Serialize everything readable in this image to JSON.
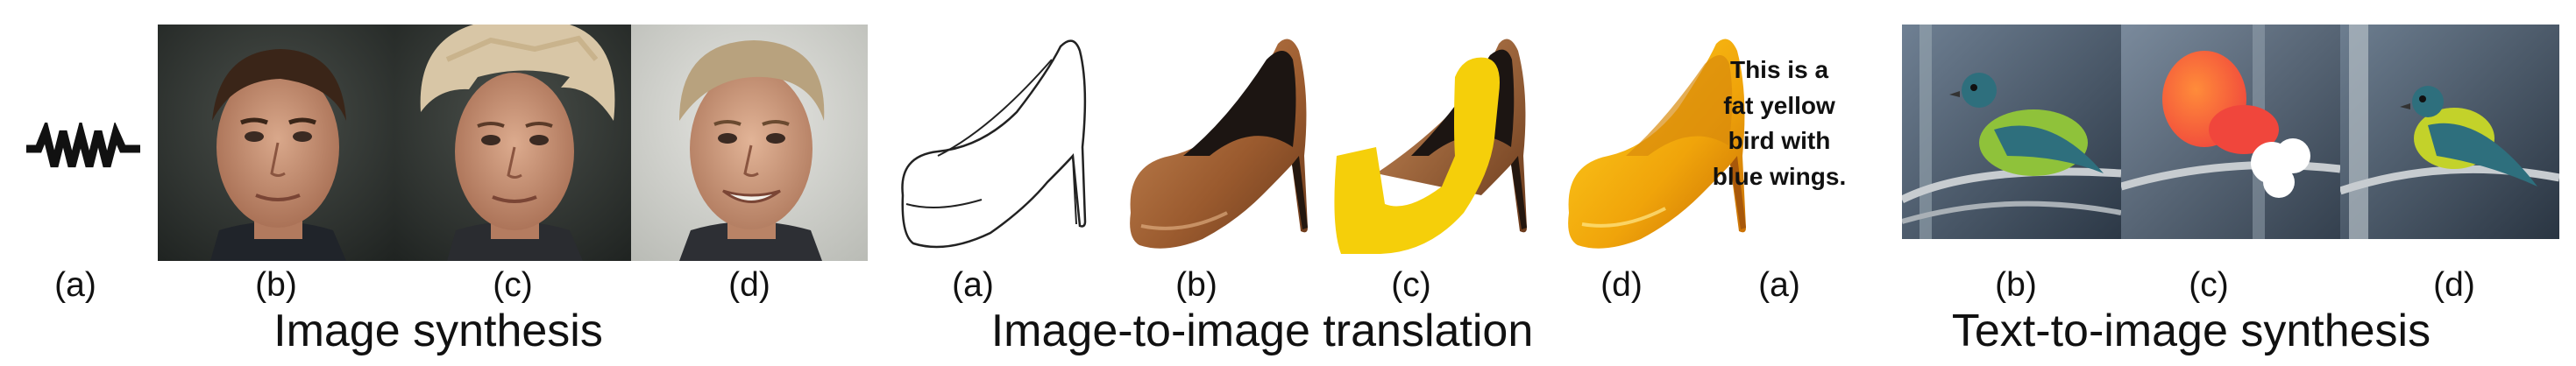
{
  "panels": [
    {
      "title": "Image synthesis",
      "labels": [
        "(a)",
        "(b)",
        "(c)",
        "(d)"
      ]
    },
    {
      "title": "Image-to-image translation",
      "labels": [
        "(a)",
        "(b)",
        "(c)",
        "(d)"
      ]
    },
    {
      "title": "Text-to-image synthesis",
      "labels": [
        "(a)",
        "(b)",
        "(c)",
        "(d)"
      ],
      "caption": "This is a\nfat yellow\nbird with\nblue wings."
    }
  ],
  "colors": {
    "text": "#111111",
    "shoe_yellow": "#f5cf0a",
    "bird_red": "#f0463c"
  }
}
